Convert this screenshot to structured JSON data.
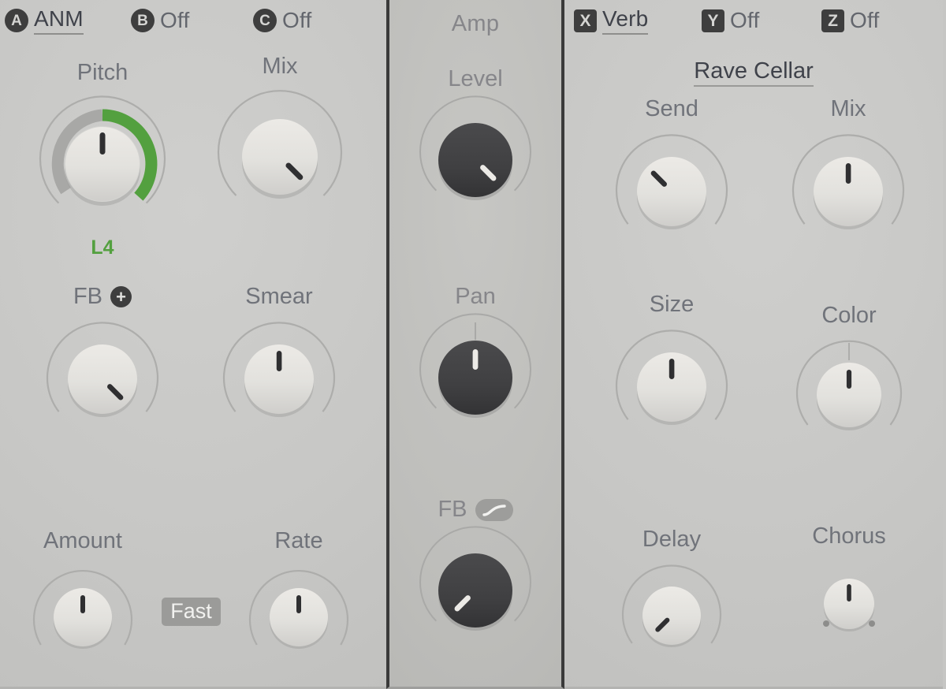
{
  "theme": {
    "panel_bg": "#c7c7c5",
    "center_panel_bg": "#bebebb",
    "divider": "#3a3a3a",
    "label_color": "#70737a",
    "accent_green": "#53a03f",
    "knob_light": "#e3e3e0",
    "knob_dark": "#3f3f41"
  },
  "left_panel": {
    "slots": [
      {
        "badge": "A",
        "badge_shape": "round",
        "name": "ANM",
        "state": "active"
      },
      {
        "badge": "B",
        "badge_shape": "round",
        "name": "Off",
        "state": "off"
      },
      {
        "badge": "C",
        "badge_shape": "round",
        "name": "Off",
        "state": "off"
      }
    ],
    "knobs": [
      {
        "label": "Pitch",
        "value": "L4",
        "angle": 0,
        "arc": "green",
        "size": "large",
        "style": "light"
      },
      {
        "label": "Mix",
        "value": "",
        "angle": 135,
        "arc": "plain",
        "size": "large",
        "style": "light"
      },
      {
        "label": "FB",
        "value": "",
        "angle": 135,
        "arc": "plain",
        "size": "medium",
        "style": "light",
        "icon": "plus-chip"
      },
      {
        "label": "Smear",
        "value": "",
        "angle": 0,
        "arc": "plain",
        "size": "medium",
        "style": "light"
      },
      {
        "label": "Amount",
        "value": "",
        "angle": 0,
        "arc": "plain",
        "size": "small",
        "style": "light"
      },
      {
        "label": "Rate",
        "value": "",
        "angle": 0,
        "arc": "plain",
        "size": "small",
        "style": "light"
      }
    ],
    "speed_toggle": "Fast"
  },
  "center_panel": {
    "title": "Amp",
    "knobs": [
      {
        "label": "Level",
        "angle": 135,
        "arc": "plain",
        "size": "medium",
        "style": "dark"
      },
      {
        "label": "Pan",
        "angle": 0,
        "arc": "detent",
        "size": "medium",
        "style": "dark"
      },
      {
        "label": "FB",
        "angle": -135,
        "arc": "plain",
        "size": "medium",
        "style": "dark",
        "icon": "curve-chip"
      }
    ]
  },
  "right_panel": {
    "slots": [
      {
        "badge": "X",
        "badge_shape": "square",
        "name": "Verb",
        "state": "active"
      },
      {
        "badge": "Y",
        "badge_shape": "square",
        "name": "Off",
        "state": "off"
      },
      {
        "badge": "Z",
        "badge_shape": "square",
        "name": "Off",
        "state": "off"
      }
    ],
    "preset": "Rave Cellar",
    "knobs": [
      {
        "label": "Send",
        "angle": -45,
        "arc": "plain",
        "size": "medium",
        "style": "light"
      },
      {
        "label": "Mix",
        "angle": 0,
        "arc": "plain",
        "size": "medium",
        "style": "light"
      },
      {
        "label": "Size",
        "angle": 0,
        "arc": "plain",
        "size": "medium",
        "style": "light"
      },
      {
        "label": "Color",
        "angle": 0,
        "arc": "detent",
        "size": "medium",
        "style": "light"
      },
      {
        "label": "Delay",
        "angle": -135,
        "arc": "plain",
        "size": "small",
        "style": "light"
      },
      {
        "label": "Chorus",
        "angle": 0,
        "arc": "dots",
        "size": "small",
        "style": "light"
      }
    ]
  }
}
